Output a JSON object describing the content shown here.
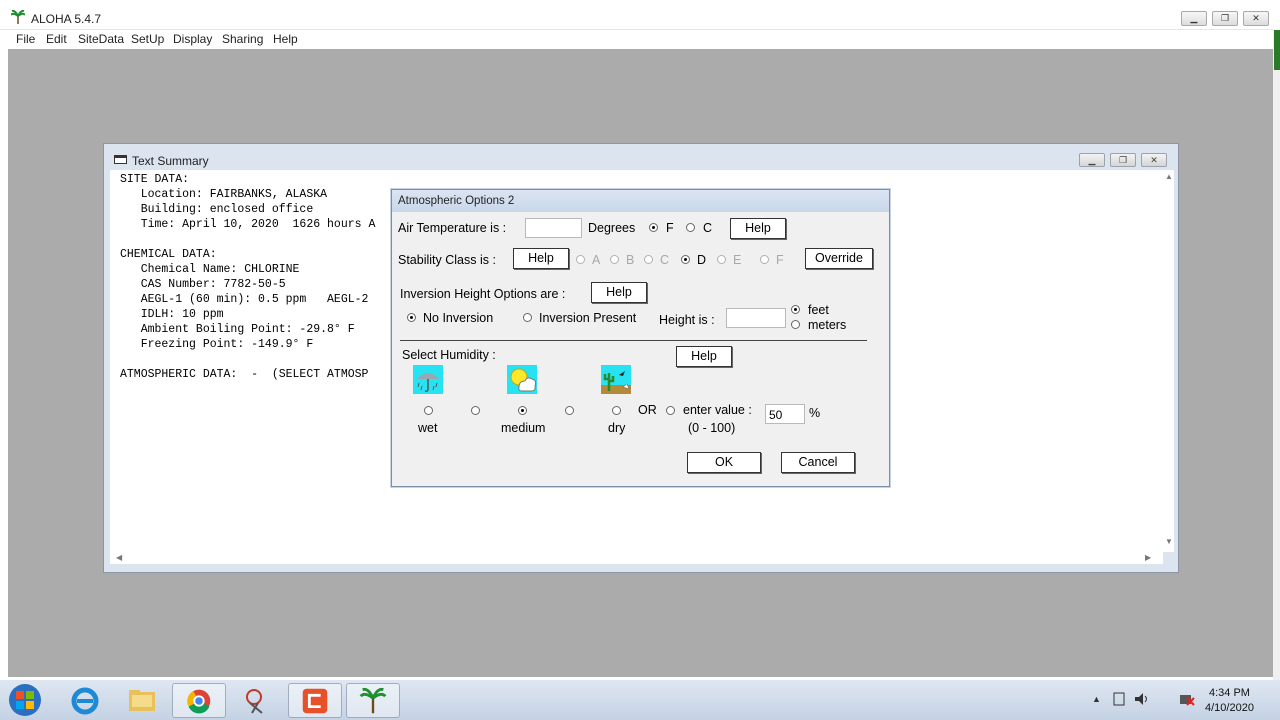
{
  "app": {
    "title": "ALOHA 5.4.7",
    "menu": [
      "File",
      "Edit",
      "SiteData",
      "SetUp",
      "Display",
      "Sharing",
      "Help"
    ]
  },
  "summary_window": {
    "title": "Text Summary",
    "lines": [
      "SITE DATA:",
      "   Location: FAIRBANKS, ALASKA",
      "   Building: enclosed office",
      "   Time: April 10, 2020  1626 hours A",
      "",
      "CHEMICAL DATA:",
      "   Chemical Name: CHLORINE",
      "   CAS Number: 7782-50-5",
      "   AEGL-1 (60 min): 0.5 ppm   AEGL-2",
      "   IDLH: 10 ppm",
      "   Ambient Boiling Point: -29.8° F",
      "   Freezing Point: -149.9° F",
      "",
      "ATMOSPHERIC DATA:  -  (SELECT ATMOSP"
    ]
  },
  "dialog": {
    "title": "Atmospheric Options 2",
    "air_temp_label": "Air Temperature is :",
    "air_temp_value": "",
    "degrees_label": "Degrees",
    "unit_f": "F",
    "unit_c": "C",
    "help_label": "Help",
    "stability_label": "Stability Class is :",
    "stability_classes": [
      "A",
      "B",
      "C",
      "D",
      "E",
      "F"
    ],
    "stability_selected": "D",
    "override_label": "Override",
    "inversion_label": "Inversion Height Options are :",
    "no_inversion_label": "No Inversion",
    "inversion_present_label": "Inversion Present",
    "height_label": "Height is :",
    "height_value": "",
    "feet_label": "feet",
    "meters_label": "meters",
    "humidity_label": "Select Humidity :",
    "hum_wet": "wet",
    "hum_medium": "medium",
    "hum_dry": "dry",
    "or_label": "OR",
    "enter_value_label": "enter value :",
    "range_label": "(0 - 100)",
    "humidity_value": "50",
    "percent_label": "%",
    "ok_label": "OK",
    "cancel_label": "Cancel"
  },
  "taskbar": {
    "time": "4:34 PM",
    "date": "4/10/2020"
  }
}
